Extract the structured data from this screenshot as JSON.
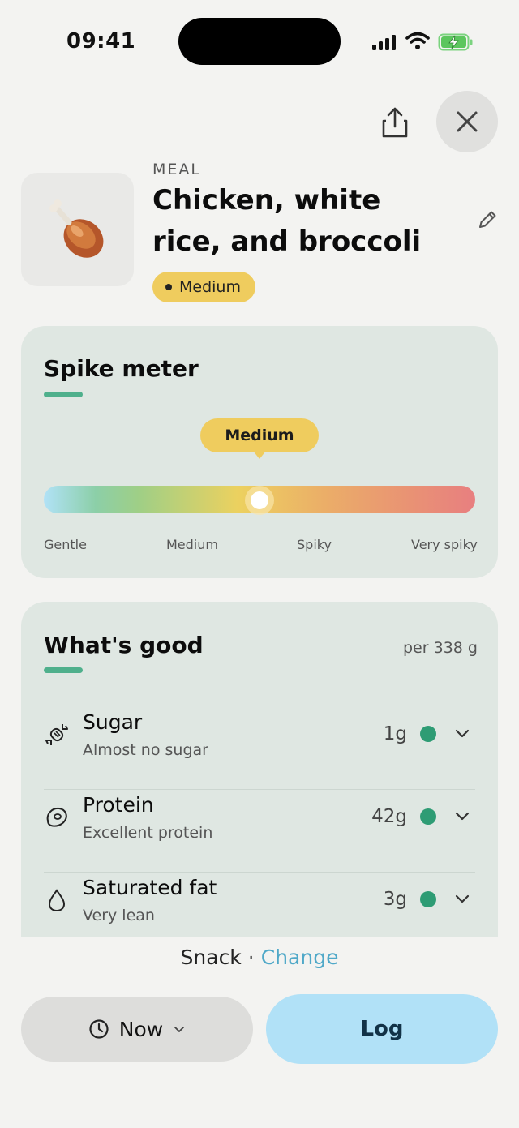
{
  "status_bar": {
    "time": "09:41"
  },
  "meal": {
    "kicker": "MEAL",
    "title": "Chicken, white rice, and broccoli",
    "badge": "Medium",
    "image_icon": "chicken-drumstick-icon"
  },
  "spike_meter": {
    "title": "Spike meter",
    "indicator_label": "Medium",
    "level_fraction": 0.5,
    "scale": [
      "Gentle",
      "Medium",
      "Spiky",
      "Very spiky"
    ]
  },
  "whats_good": {
    "title": "What's good",
    "per": "per 338 g",
    "items": [
      {
        "name": "Sugar",
        "description": "Almost no sugar",
        "value": "1g",
        "icon": "candy-icon",
        "status_color": "#2e9c74"
      },
      {
        "name": "Protein",
        "description": "Excellent protein",
        "value": "42g",
        "icon": "steak-icon",
        "status_color": "#2e9c74"
      },
      {
        "name": "Saturated fat",
        "description": "Very lean",
        "value": "3g",
        "icon": "drop-icon",
        "status_color": "#2e9c74"
      }
    ]
  },
  "footer": {
    "meal_type": "Snack",
    "separator": "·",
    "change_link": "Change",
    "time_label": "Now",
    "log_label": "Log"
  },
  "colors": {
    "accent_yellow": "#efcc5e",
    "accent_green": "#4fb08c",
    "log_button": "#b1e1f7",
    "card_bg": "#dfe7e2"
  }
}
